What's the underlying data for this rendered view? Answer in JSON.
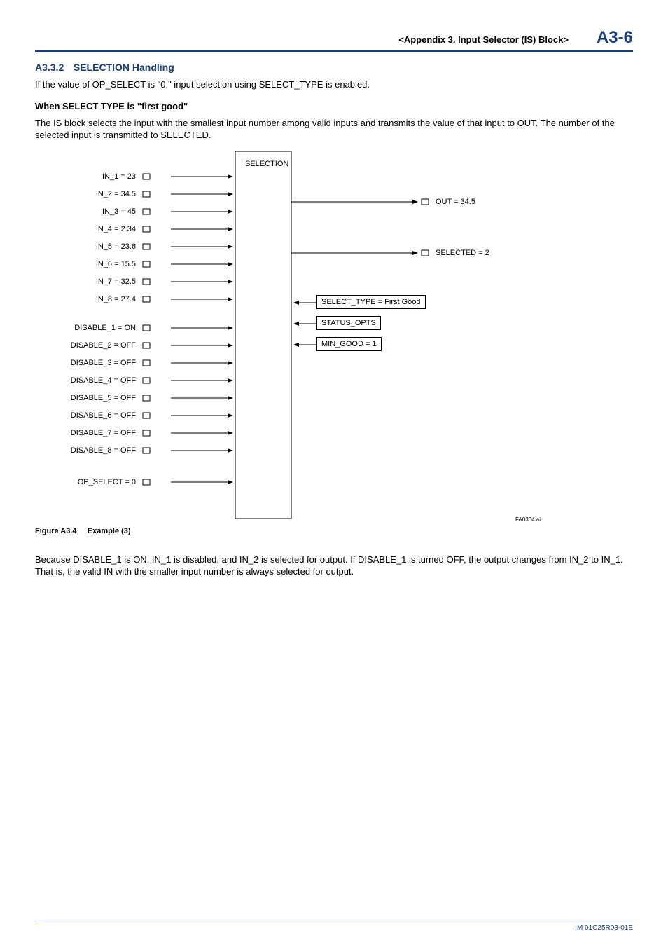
{
  "header": {
    "title": "<Appendix 3.  Input Selector (IS) Block>",
    "page": "A3-6"
  },
  "section": {
    "number": "A3.3.2",
    "title": "SELECTION Handling"
  },
  "intro": "If the value of OP_SELECT is \"0,\" input selection using SELECT_TYPE is enabled.",
  "subhead": "When SELECT TYPE is \"first good\"",
  "para2": "The IS block selects the input with the smallest input number among valid inputs and transmits the value of that input to OUT. The number of the selected input is transmitted to SELECTED.",
  "diagram": {
    "selection_label": "SELECTION",
    "inputs": [
      "IN_1 = 23",
      "IN_2 = 34.5",
      "IN_3 = 45",
      "IN_4 = 2.34",
      "IN_5 = 23.6",
      "IN_6 = 15.5",
      "IN_7 = 32.5",
      "IN_8 = 27.4"
    ],
    "disables": [
      "DISABLE_1 = ON",
      "DISABLE_2 = OFF",
      "DISABLE_3 = OFF",
      "DISABLE_4 = OFF",
      "DISABLE_5 = OFF",
      "DISABLE_6 = OFF",
      "DISABLE_7 = OFF",
      "DISABLE_8 = OFF"
    ],
    "op_select": "OP_SELECT = 0",
    "out": "OUT = 34.5",
    "selected": "SELECTED = 2",
    "select_type": "SELECT_TYPE = First Good",
    "status_opts": "STATUS_OPTS",
    "min_good": "MIN_GOOD = 1",
    "img_ref": "FA0304.ai"
  },
  "figure_caption_num": "Figure A3.4",
  "figure_caption_txt": "Example (3)",
  "para3": "Because DISABLE_1 is ON, IN_1 is disabled, and IN_2 is selected for output. If DISABLE_1 is turned OFF, the output changes from IN_2 to IN_1. That is, the valid IN with the smaller input number is always selected for output.",
  "footer": "IM 01C25R03-01E"
}
